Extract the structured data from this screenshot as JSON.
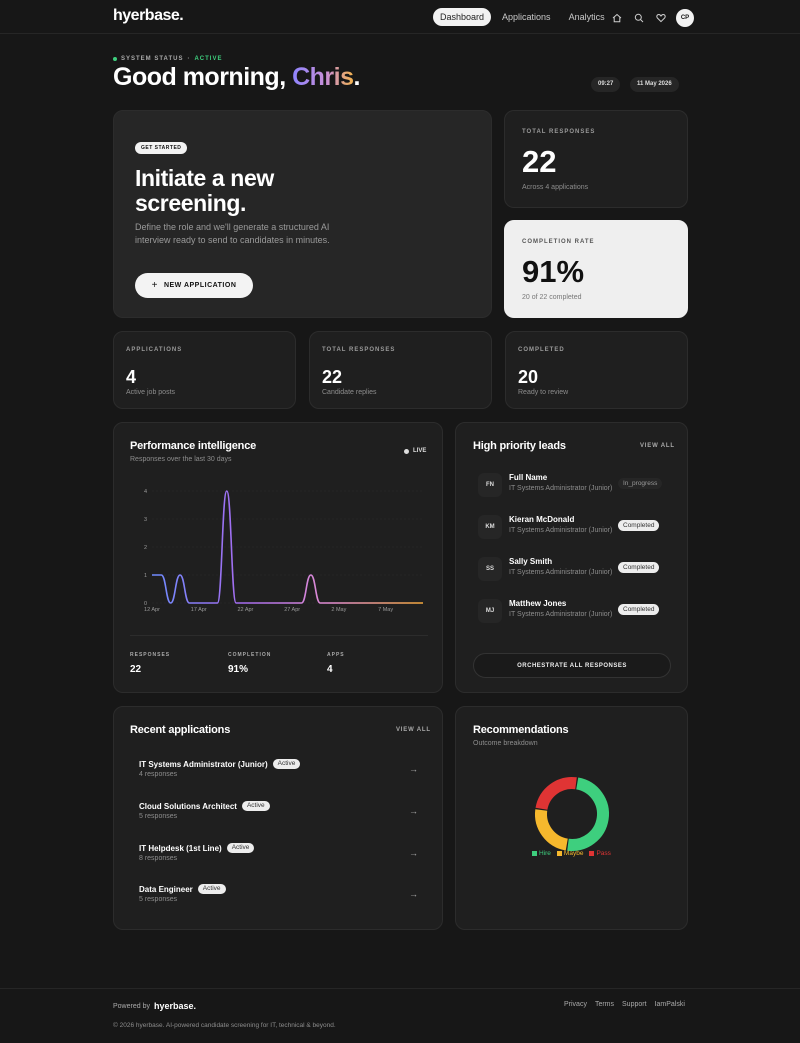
{
  "nav": {
    "logo": "hyerbase",
    "logo_dot": ".",
    "tabs": [
      {
        "label": "Dashboard",
        "active": true
      },
      {
        "label": "Applications",
        "active": false
      },
      {
        "label": "Analytics",
        "active": false
      }
    ],
    "avatar_initials": "CP"
  },
  "header": {
    "status_label": "SYSTEM STATUS",
    "status_sep": "·",
    "status_value": "ACTIVE",
    "greeting_prefix": "Good morning, ",
    "greeting_name": "Chris",
    "greeting_suffix": ".",
    "time": "09:27",
    "date": "11 May 2026"
  },
  "hero": {
    "badge": "GET STARTED",
    "title": "Initiate a new screening.",
    "description": "Define the role and we'll generate a structured AI interview ready to send to candidates in minutes.",
    "button_icon": "+",
    "button_label": "NEW APPLICATION"
  },
  "total_responses_card": {
    "label": "TOTAL RESPONSES",
    "value": "22",
    "sub": "Across 4 applications"
  },
  "completion_card": {
    "label": "COMPLETION RATE",
    "value": "91%",
    "sub": "20 of 22 completed"
  },
  "mini_stats": [
    {
      "label": "APPLICATIONS",
      "value": "4",
      "sub": "Active job posts"
    },
    {
      "label": "TOTAL RESPONSES",
      "value": "22",
      "sub": "Candidate replies"
    },
    {
      "label": "COMPLETED",
      "value": "20",
      "sub": "Ready to review"
    }
  ],
  "performance": {
    "title": "Performance intelligence",
    "subtitle": "Responses over the last 30 days",
    "live_label": "LIVE",
    "stats": [
      {
        "label": "RESPONSES",
        "value": "22"
      },
      {
        "label": "COMPLETION",
        "value": "91%"
      },
      {
        "label": "APPS",
        "value": "4"
      }
    ]
  },
  "chart_data": {
    "type": "line",
    "title": "",
    "xlabel": "",
    "ylabel": "",
    "x_ticks": [
      "12 Apr",
      "17 Apr",
      "22 Apr",
      "27 Apr",
      "2 May",
      "7 May"
    ],
    "y_ticks": [
      "0",
      "1",
      "2",
      "3",
      "4"
    ],
    "ylim": [
      0,
      4
    ],
    "grid": true,
    "line_gradient": [
      "#6f8cff",
      "#a66cf0",
      "#e58fd2",
      "#f3a83b"
    ],
    "x": [
      "12 Apr",
      "13 Apr",
      "14 Apr",
      "15 Apr",
      "16 Apr",
      "17 Apr",
      "18 Apr",
      "19 Apr",
      "20 Apr",
      "21 Apr",
      "22 Apr",
      "23 Apr",
      "24 Apr",
      "25 Apr",
      "26 Apr",
      "27 Apr",
      "28 Apr",
      "29 Apr",
      "30 Apr",
      "1 May",
      "2 May",
      "3 May",
      "4 May",
      "5 May",
      "6 May",
      "7 May",
      "8 May",
      "9 May",
      "10 May",
      "11 May"
    ],
    "series": [
      {
        "values": [
          1,
          1,
          0,
          1,
          0,
          0,
          0,
          0,
          4,
          0,
          0,
          0,
          0,
          0,
          0,
          0,
          0,
          1,
          0,
          0,
          0,
          0,
          0,
          0,
          0,
          0,
          0,
          0,
          0,
          0
        ]
      }
    ]
  },
  "leads": {
    "title": "High priority leads",
    "view_all": "VIEW ALL",
    "items": [
      {
        "initials": "FN",
        "name": "Full Name",
        "role": "IT Systems Administrator (Junior)",
        "status": "In_progress"
      },
      {
        "initials": "KM",
        "name": "Kieran McDonald",
        "role": "IT Systems Administrator (Junior)",
        "status": "Completed"
      },
      {
        "initials": "SS",
        "name": "Sally Smith",
        "role": "IT Systems Administrator (Junior)",
        "status": "Completed"
      },
      {
        "initials": "MJ",
        "name": "Matthew Jones",
        "role": "IT Systems Administrator (Junior)",
        "status": "Completed"
      }
    ],
    "button_label": "ORCHESTRATE ALL RESPONSES"
  },
  "recent": {
    "title": "Recent applications",
    "view_all": "VIEW ALL",
    "items": [
      {
        "title": "IT Systems Administrator (Junior)",
        "badge": "Active",
        "sub": "4 responses"
      },
      {
        "title": "Cloud Solutions Architect",
        "badge": "Active",
        "sub": "5 responses"
      },
      {
        "title": "IT Helpdesk (1st Line)",
        "badge": "Active",
        "sub": "8 responses"
      },
      {
        "title": "Data Engineer",
        "badge": "Active",
        "sub": "5 responses"
      }
    ],
    "arrow": "→"
  },
  "recommendations": {
    "title": "Recommendations",
    "subtitle": "Outcome breakdown",
    "slices": [
      {
        "label": "Hire",
        "value": 50,
        "color": "#3ecf7e"
      },
      {
        "label": "Maybe",
        "value": 25,
        "color": "#f6b82d"
      },
      {
        "label": "Pass",
        "value": 25,
        "color": "#e03434"
      }
    ]
  },
  "footer": {
    "powered_by": "Powered by",
    "logo": "hyerbase.",
    "links": [
      "Privacy",
      "Terms",
      "Support",
      "IamPalski"
    ],
    "copyright": "© 2026 hyerbase. AI-powered candidate screening for IT, technical & beyond."
  }
}
